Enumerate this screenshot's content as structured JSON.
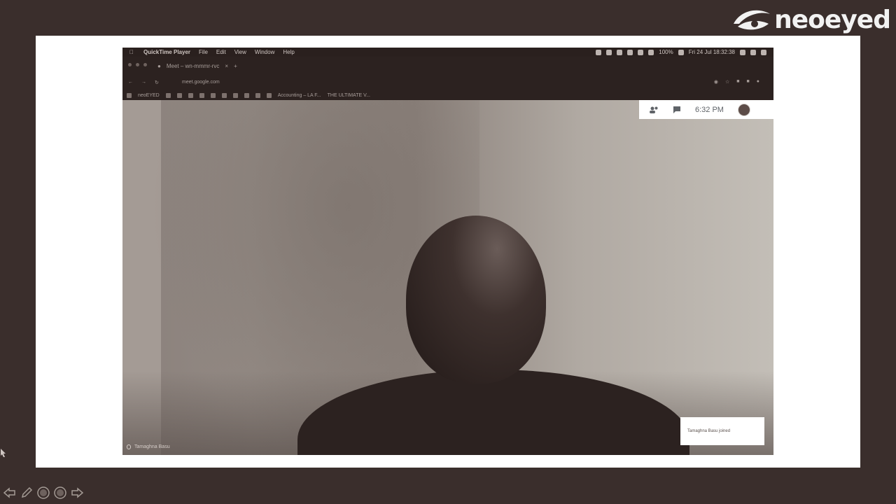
{
  "brand": {
    "name": "neoeyed",
    "text_color": "#f2f2f2"
  },
  "menubar": {
    "app": "QuickTime Player",
    "menus": [
      "File",
      "Edit",
      "View",
      "Window",
      "Help"
    ],
    "battery": "100%",
    "datetime": "Fri 24 Jul 18:32:38"
  },
  "browser": {
    "tab_title": "Meet – wn-mmmr-rvc",
    "url": "meet.google.com",
    "bookmarks": [
      "neoEYED",
      "Accounting – LA F...",
      "THE ULTIMATE V..."
    ]
  },
  "meet": {
    "time": "6:32 PM",
    "toast": "Tamaghna Basu joined",
    "participant_name": "Tamaghna Basu"
  },
  "icons": {
    "logo": "neoeyed-eye-logo",
    "apple": "apple-icon",
    "people": "people-icon",
    "chat": "chat-icon",
    "avatar": "user-avatar",
    "mic": "mic-icon"
  },
  "toolbar_icons": [
    "arrow-left-icon",
    "pen-icon",
    "circle-icon",
    "circle-icon",
    "arrow-right-icon"
  ]
}
